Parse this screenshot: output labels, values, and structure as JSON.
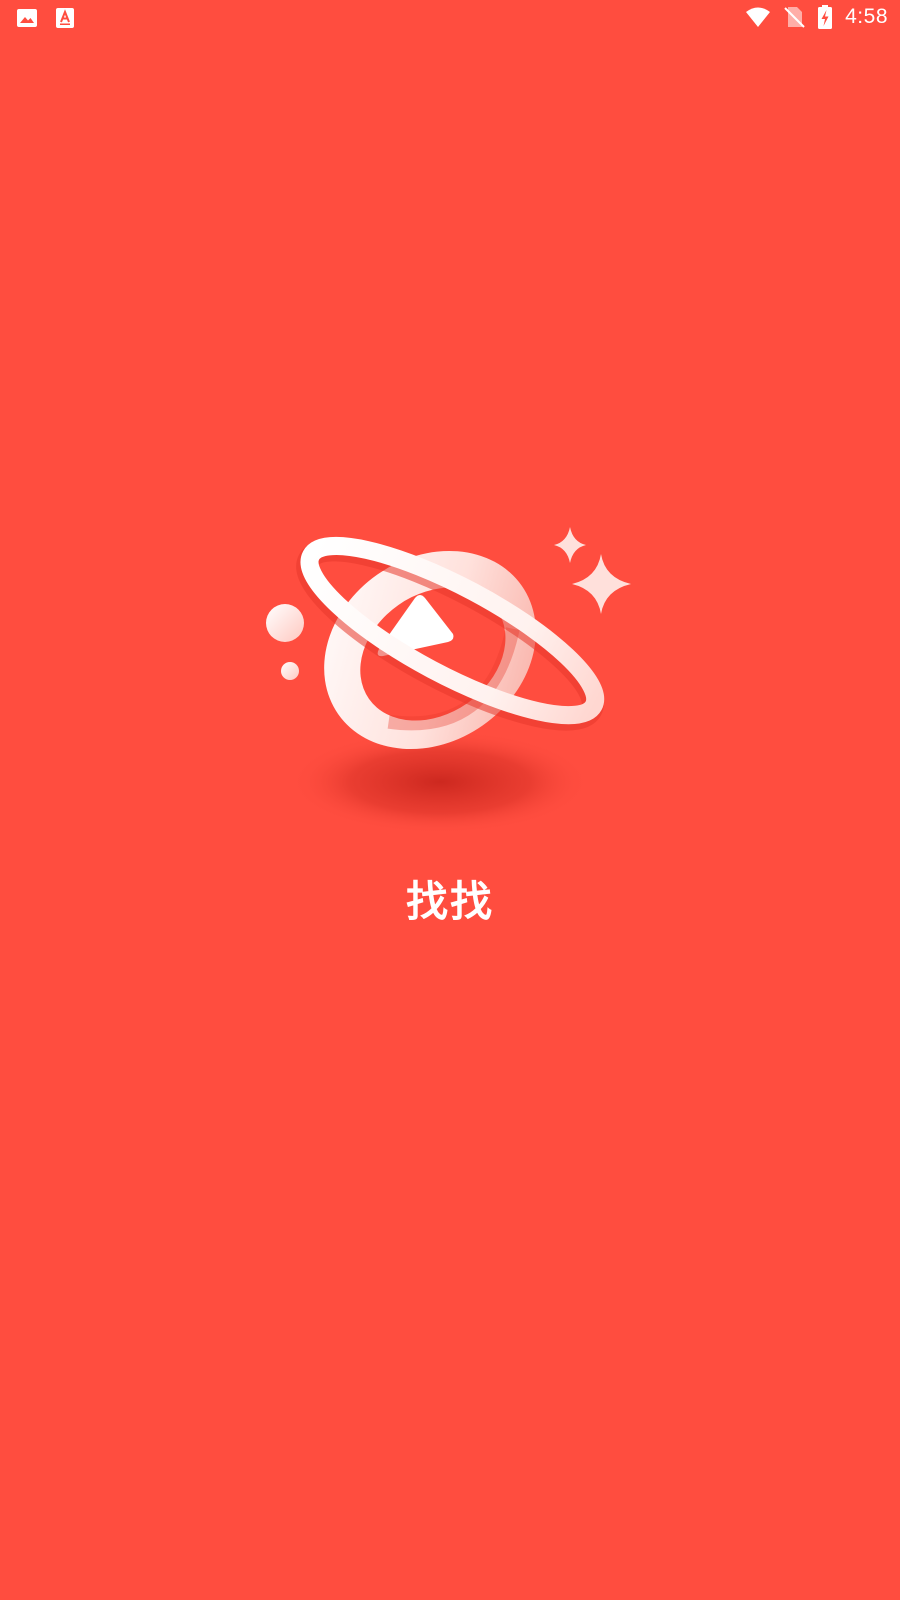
{
  "status_bar": {
    "time": "4:58",
    "left_icons": [
      "gallery-icon",
      "text-app-icon"
    ],
    "right_icons": [
      "wifi-icon",
      "no-sim-icon",
      "battery-charging-icon"
    ]
  },
  "splash": {
    "app_name": "找找",
    "logo": "planet-play-logo"
  },
  "colors": {
    "background": "#ff4d3f",
    "foreground": "#ffffff"
  }
}
